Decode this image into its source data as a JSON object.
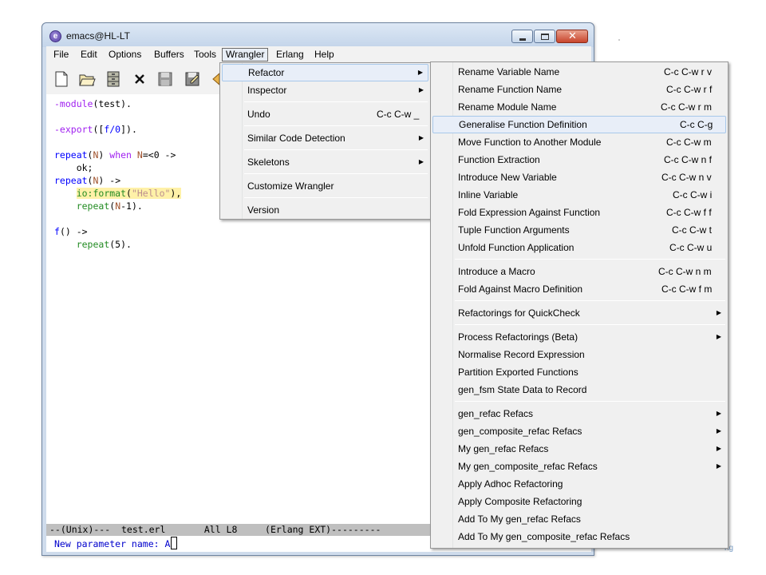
{
  "window": {
    "title": "emacs@HL-LT"
  },
  "menubar": [
    "File",
    "Edit",
    "Options",
    "Buffers",
    "Tools",
    "Wrangler",
    "Erlang",
    "Help"
  ],
  "toolbar": [
    "new-file-icon",
    "open-folder-icon",
    "cabinet-icon",
    "close-icon",
    "save-disk-icon",
    "save-as-icon",
    "undo-icon"
  ],
  "editor": {
    "lines": [
      {
        "segments": [
          {
            "t": "-module",
            "c": "kw"
          },
          {
            "t": "(test).",
            "c": ""
          }
        ]
      },
      {
        "segments": []
      },
      {
        "segments": [
          {
            "t": "-export",
            "c": "kw"
          },
          {
            "t": "([",
            "c": ""
          },
          {
            "t": "f/0",
            "c": "fn"
          },
          {
            "t": "]).",
            "c": ""
          }
        ]
      },
      {
        "segments": []
      },
      {
        "segments": [
          {
            "t": "repeat",
            "c": "fn"
          },
          {
            "t": "(",
            "c": ""
          },
          {
            "t": "N",
            "c": "var"
          },
          {
            "t": ") ",
            "c": ""
          },
          {
            "t": "when",
            "c": "kw"
          },
          {
            "t": " ",
            "c": ""
          },
          {
            "t": "N",
            "c": "var"
          },
          {
            "t": "=<0 ->",
            "c": ""
          }
        ]
      },
      {
        "segments": [
          {
            "t": "    ok;",
            "c": ""
          }
        ]
      },
      {
        "segments": [
          {
            "t": "repeat",
            "c": "fn"
          },
          {
            "t": "(",
            "c": ""
          },
          {
            "t": "N",
            "c": "var"
          },
          {
            "t": ") ->",
            "c": ""
          }
        ]
      },
      {
        "segments": [
          {
            "t": "    ",
            "c": ""
          },
          {
            "t": "io:format",
            "c": "call hl"
          },
          {
            "t": "(",
            "c": "hl"
          },
          {
            "t": "\"Hello\"",
            "c": "str hl"
          },
          {
            "t": "),",
            "c": "hl"
          }
        ]
      },
      {
        "segments": [
          {
            "t": "    ",
            "c": ""
          },
          {
            "t": "repeat",
            "c": "call"
          },
          {
            "t": "(",
            "c": ""
          },
          {
            "t": "N",
            "c": "var"
          },
          {
            "t": "-1).",
            "c": ""
          }
        ]
      },
      {
        "segments": []
      },
      {
        "segments": [
          {
            "t": "f",
            "c": "fn"
          },
          {
            "t": "() ->",
            "c": ""
          }
        ]
      },
      {
        "segments": [
          {
            "t": "    ",
            "c": ""
          },
          {
            "t": "repeat",
            "c": "call"
          },
          {
            "t": "(5).",
            "c": ""
          }
        ]
      }
    ]
  },
  "modeline": "--(Unix)---  test.erl       All L8     (Erlang EXT)---------",
  "minibuffer": {
    "prompt": "New parameter name: ",
    "value": "A"
  },
  "wrangler_menu": [
    {
      "label": "Refactor",
      "submenu": true,
      "hover": true
    },
    {
      "label": "Inspector",
      "submenu": true
    },
    {
      "sep": true
    },
    {
      "label": "Undo",
      "shortcut": "C-c C-w _"
    },
    {
      "sep": true
    },
    {
      "label": "Similar Code Detection",
      "submenu": true
    },
    {
      "sep": true
    },
    {
      "label": "Skeletons",
      "submenu": true
    },
    {
      "sep": true
    },
    {
      "label": "Customize Wrangler"
    },
    {
      "sep": true
    },
    {
      "label": "Version"
    }
  ],
  "refactor_menu": [
    {
      "label": "Rename Variable Name",
      "shortcut": "C-c C-w r v"
    },
    {
      "label": "Rename Function Name",
      "shortcut": "C-c C-w r f"
    },
    {
      "label": "Rename Module Name",
      "shortcut": "C-c C-w r m"
    },
    {
      "label": "Generalise Function Definition",
      "shortcut": "C-c C-g",
      "hover": true
    },
    {
      "label": "Move Function to Another Module",
      "shortcut": "C-c C-w m"
    },
    {
      "label": "Function Extraction",
      "shortcut": "C-c C-w n f"
    },
    {
      "label": "Introduce New Variable",
      "shortcut": "C-c C-w n v"
    },
    {
      "label": "Inline Variable",
      "shortcut": "C-c C-w i"
    },
    {
      "label": "Fold Expression Against Function",
      "shortcut": "C-c C-w f f"
    },
    {
      "label": "Tuple Function Arguments",
      "shortcut": "C-c C-w t"
    },
    {
      "label": "Unfold Function Application",
      "shortcut": "C-c C-w u"
    },
    {
      "sep": true
    },
    {
      "label": "Introduce a Macro",
      "shortcut": "C-c C-w n m"
    },
    {
      "label": "Fold Against Macro Definition",
      "shortcut": "C-c C-w f m"
    },
    {
      "sep": true
    },
    {
      "label": "Refactorings for QuickCheck",
      "submenu": true
    },
    {
      "sep": true
    },
    {
      "label": "Process Refactorings (Beta)",
      "submenu": true
    },
    {
      "label": "Normalise Record Expression"
    },
    {
      "label": "Partition Exported Functions"
    },
    {
      "label": "gen_fsm State Data to Record"
    },
    {
      "sep": true
    },
    {
      "label": "gen_refac Refacs",
      "submenu": true
    },
    {
      "label": "gen_composite_refac Refacs",
      "submenu": true
    },
    {
      "label": "My gen_refac Refacs",
      "submenu": true
    },
    {
      "label": "My gen_composite_refac Refacs",
      "submenu": true
    },
    {
      "label": "Apply Adhoc Refactoring"
    },
    {
      "label": "Apply Composite Refactoring"
    },
    {
      "label": "Add To My gen_refac Refacs"
    },
    {
      "label": "Add To My gen_composite_refac Refacs"
    }
  ],
  "background_fragment": "ng",
  "colors": {
    "menu_hover_border": "#a8c8ea",
    "titlebar": "#cfdcec",
    "modeline": "#bfbfbf"
  }
}
